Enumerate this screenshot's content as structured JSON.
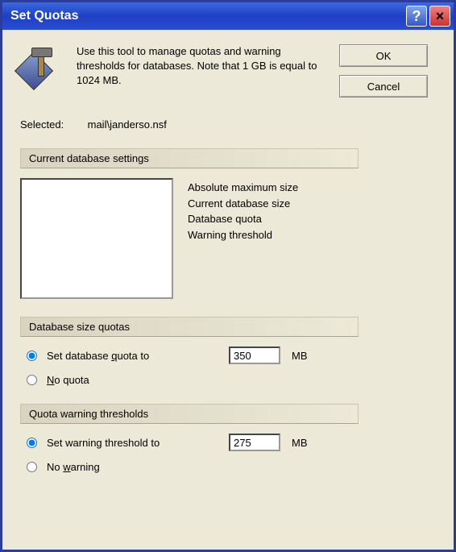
{
  "window": {
    "title": "Set Quotas"
  },
  "buttons": {
    "ok": "OK",
    "cancel": "Cancel"
  },
  "description": "Use this tool to manage quotas and warning thresholds for databases. Note that 1 GB is equal to 1024 MB.",
  "selected": {
    "label": "Selected:",
    "value": "mail\\janderso.nsf"
  },
  "groups": {
    "current": "Current database settings",
    "quotas": "Database size quotas",
    "warnings": "Quota warning thresholds"
  },
  "settings_labels": {
    "abs_max": "Absolute maximum size",
    "cur_size": "Current database size",
    "db_quota": "Database quota",
    "warn_thresh": "Warning threshold"
  },
  "quota": {
    "set_prefix": "Set database ",
    "set_hot": "q",
    "set_suffix": "uota to",
    "value": "350",
    "unit": "MB",
    "none_hot": "N",
    "none_suffix": "o quota"
  },
  "warning": {
    "set_label": "Set warning threshold to",
    "value": "275",
    "unit": "MB",
    "none_prefix": "No ",
    "none_hot": "w",
    "none_suffix": "arning"
  }
}
